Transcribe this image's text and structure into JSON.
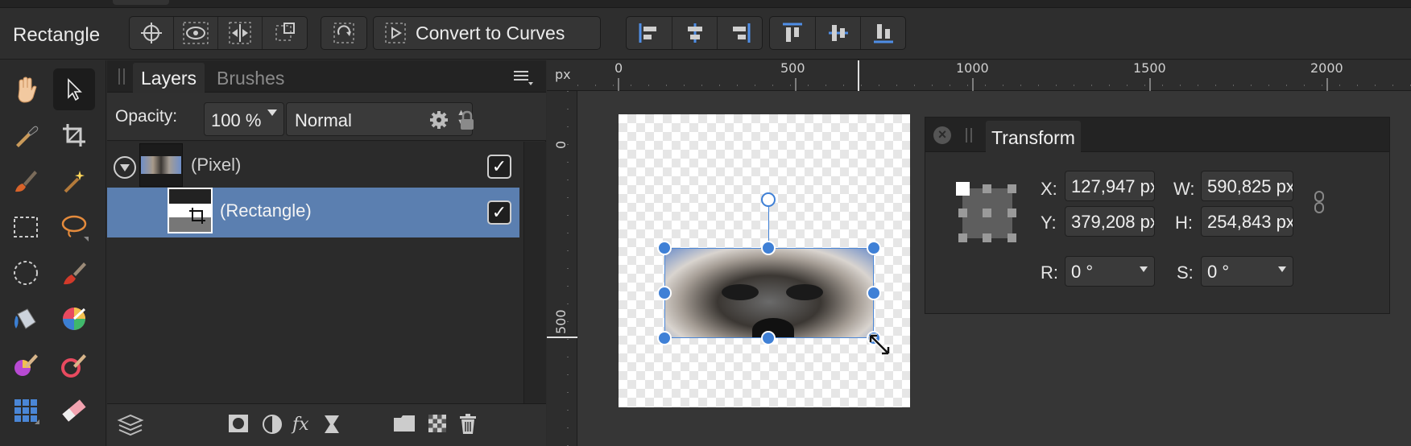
{
  "toolbar": {
    "tool_name": "Rectangle",
    "convert_label": "Convert to Curves",
    "buttons": [
      "crosshair-icon",
      "eye-show-icon",
      "flip-horizontal-icon",
      "transform-origin-icon",
      "rotate-icon",
      "convert-curves-icon",
      "align-left-icon",
      "align-center-icon",
      "align-right-icon",
      "align-top-icon",
      "align-middle-icon",
      "align-bottom-icon"
    ]
  },
  "tools": [
    "hand-tool-icon",
    "move-tool-icon",
    "color-picker-icon",
    "crop-tool-icon",
    "paint-brush-icon",
    "magic-wand-icon",
    "rectangular-marquee-icon",
    "freehand-selection-icon",
    "elliptical-marquee-icon",
    "brush-tool-icon",
    "flood-fill-icon",
    "color-wheel-icon",
    "color-brush-icon",
    "color-replace-icon",
    "pixel-grid-icon",
    "eraser-tool-icon"
  ],
  "layers_panel": {
    "tabs": [
      {
        "label": "Layers",
        "active": true
      },
      {
        "label": "Brushes",
        "active": false
      }
    ],
    "opacity_label": "Opacity:",
    "opacity_value": "100 %",
    "blend_mode": "Normal",
    "layers": [
      {
        "name": "(Pixel)",
        "visible": true,
        "selected": false
      },
      {
        "name": "(Rectangle)",
        "visible": true,
        "selected": true
      }
    ],
    "check_glyph": "✓"
  },
  "canvas": {
    "unit": "px",
    "ruler_x_labels": [
      "0",
      "500",
      "1000",
      "1500",
      "2000"
    ],
    "ruler_y_labels": [
      "0",
      "500"
    ]
  },
  "transform_panel": {
    "title": "Transform",
    "close_glyph": "×",
    "x_label": "X:",
    "x_value": "127,947 px",
    "y_label": "Y:",
    "y_value": "379,208 px",
    "w_label": "W:",
    "w_value": "590,825 px",
    "h_label": "H:",
    "h_value": "254,843 px",
    "r_label": "R:",
    "r_value": "0 °",
    "s_label": "S:",
    "s_value": "0 °"
  },
  "colors": {
    "selection_blue": "#5b7fb0",
    "handle_blue": "#3f80d6"
  }
}
